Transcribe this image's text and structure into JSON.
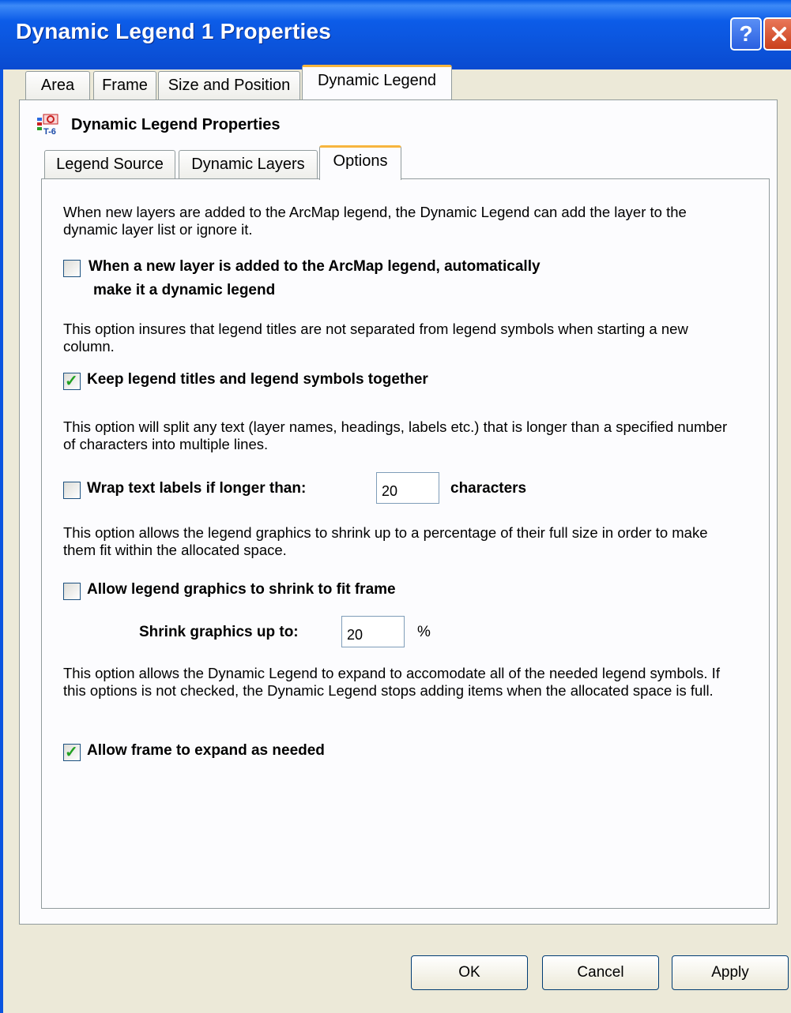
{
  "window": {
    "title": "Dynamic Legend 1 Properties",
    "help_glyph": "?"
  },
  "outer_tabs": [
    {
      "label": "Area",
      "active": false
    },
    {
      "label": "Frame",
      "active": false
    },
    {
      "label": "Size and Position",
      "active": false
    },
    {
      "label": "Dynamic Legend",
      "active": true
    }
  ],
  "panel_header": {
    "title": "Dynamic Legend Properties",
    "icon": "dynamic-legend-icon"
  },
  "inner_tabs": [
    {
      "label": "Legend Source",
      "active": false
    },
    {
      "label": "Dynamic Layers",
      "active": false
    },
    {
      "label": "Options",
      "active": true
    }
  ],
  "options": {
    "para1": "When new layers are added to the ArcMap legend, the Dynamic Legend can add the layer to the dynamic layer list or ignore it.",
    "auto_dynamic": {
      "label_line1": "When a new layer is added to the ArcMap legend, automatically",
      "label_line2": "make it a dynamic legend",
      "checked": false
    },
    "para2": "This option insures that legend titles are not separated from legend symbols when starting a new column.",
    "keep_together": {
      "label": "Keep legend titles and legend symbols together",
      "checked": true
    },
    "para3": "This option will split any text (layer names, headings, labels etc.) that is longer than a specified number of characters into multiple lines.",
    "wrap_text": {
      "label": "Wrap text labels if longer than:",
      "value": "20",
      "unit": "characters",
      "checked": false
    },
    "para4": "This option allows the legend graphics to shrink up to a percentage of their full size in order to make them fit within the allocated space.",
    "shrink": {
      "label": "Allow legend graphics to shrink to fit frame",
      "checked": false,
      "sub_label": "Shrink graphics up to:",
      "value": "20",
      "unit": "%"
    },
    "para5": "This option allows the Dynamic Legend to expand to accomodate all of the needed legend symbols.  If this options is not checked, the Dynamic Legend stops adding items when the allocated space is full.",
    "expand": {
      "label": "Allow frame to expand as needed",
      "checked": true
    }
  },
  "buttons": {
    "ok": "OK",
    "cancel": "Cancel",
    "apply": "Apply"
  },
  "colors": {
    "titlebar": "#0b53da",
    "tab_highlight": "#f7b53e",
    "check_mark": "#21a121",
    "dialog_bg": "#ece9d8"
  }
}
